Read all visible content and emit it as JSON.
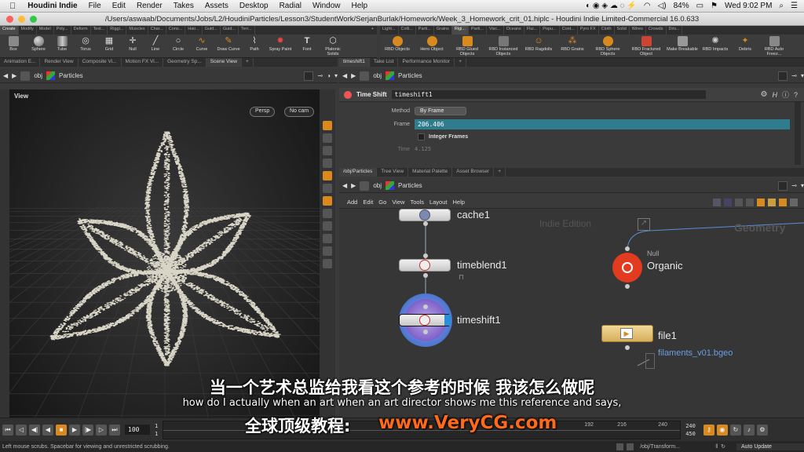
{
  "menubar": {
    "app": "Houdini Indie",
    "items": [
      "File",
      "Edit",
      "Render",
      "Takes",
      "Assets",
      "Desktop",
      "Radial",
      "Window",
      "Help"
    ],
    "battery": "84%",
    "clock": "Wed 9:02 PM"
  },
  "window_title": "/Users/aswaab/Documents/Jobs/L2/HoudiniParticles/Lesson3/StudentWork/SerjanBurlak/Homework/Week_3_Homework_crit_01.hiplc - Houdini Indie Limited-Commercial 16.0.633",
  "shelf_left": {
    "tabs": [
      "Create",
      "Modify",
      "Model",
      "Poly...",
      "Deform",
      "Text...",
      "Riggi...",
      "Muscles",
      "Char...",
      "Cons...",
      "Hair...",
      "Guid...",
      "Guid...",
      "Terr..."
    ],
    "tools": [
      "Box",
      "Sphere",
      "Tube",
      "Torus",
      "Grid",
      "Null",
      "Line",
      "Circle",
      "Curve",
      "Draw Curve",
      "Path",
      "Spray Paint",
      "Font",
      "Platonic Solids"
    ]
  },
  "shelf_right": {
    "tabs": [
      "Light...",
      "Colli...",
      "Parti...",
      "Grains",
      "Rigi...",
      "Parti...",
      "Visc...",
      "Oceans",
      "Flui...",
      "Popu...",
      "Cont...",
      "Pyro FX",
      "Cloth",
      "Solid",
      "Wires",
      "Crowds",
      "Driv..."
    ],
    "tools": [
      "RBD Objects",
      "Hero Object",
      "RBD Glued Objects",
      "RBD Instanced Objects",
      "RBD Ragdolls",
      "RBD Grains",
      "RBD Sphere Objects",
      "RBD Fractured Object",
      "Make Breakable",
      "RBD Impacts",
      "Debris",
      "RBD Auto Freez..."
    ]
  },
  "left_pane": {
    "tabs": [
      "Animation E...",
      "Render View",
      "Composite Vi...",
      "Motion FX Vi...",
      "Geometry Sp...",
      "Scene View"
    ],
    "path_root": "obj",
    "path_node": "Particles",
    "view_label": "View",
    "persp": "Persp",
    "cam": "No cam"
  },
  "param_pane": {
    "tabs": [
      "timeshift1",
      "Take List",
      "Performance Monitor"
    ],
    "path_root": "obj",
    "path_node": "Particles",
    "node_type": "Time Shift",
    "node_name": "timeshift1",
    "method_label": "Method",
    "method_value": "By Frame",
    "frame_label": "Frame",
    "frame_value": "206.406",
    "integer_frames": "Integer Frames",
    "time_label": "Time",
    "time_value": "4.125"
  },
  "network_pane": {
    "tabs": [
      "/obj/Particles",
      "Tree View",
      "Material Palette",
      "Asset Browser"
    ],
    "path_root": "obj",
    "path_node": "Particles",
    "menu": [
      "Add",
      "Edit",
      "Go",
      "View",
      "Tools",
      "Layout",
      "Help"
    ],
    "watermark_edition": "Indie Edition",
    "watermark_context": "Geometry",
    "nodes": {
      "cache": "cache1",
      "timeblend": "timeblend1",
      "timeshift": "timeshift1",
      "null_type": "Null",
      "null_name": "Organic",
      "file_name": "file1",
      "file_path": "filaments_v01.bgeo"
    }
  },
  "subtitles": {
    "chinese": "当一个艺术总监给我看这个参考的时候 我该怎么做呢",
    "english": "how do I actually when an art when an art director shows me this reference and says,",
    "promo_prefix": "全球顶级教程:",
    "promo_url": "www.VeryCG.com"
  },
  "timeline": {
    "current_frame": "100",
    "start": "1",
    "start2": "1",
    "ticks": [
      "192",
      "216",
      "240"
    ],
    "end": "240",
    "end2": "450",
    "auto_update": "Auto Update"
  },
  "status": {
    "message": "Left mouse scrubs. Spacebar for viewing and unrestricted scrubbing.",
    "path": "/obj/Transform..."
  },
  "colors": {
    "accent_orange": "#d98a1f",
    "null_red": "#e23b1f",
    "selected_blue": "#5a7fd8",
    "frame_field": "#2f7d8c"
  }
}
